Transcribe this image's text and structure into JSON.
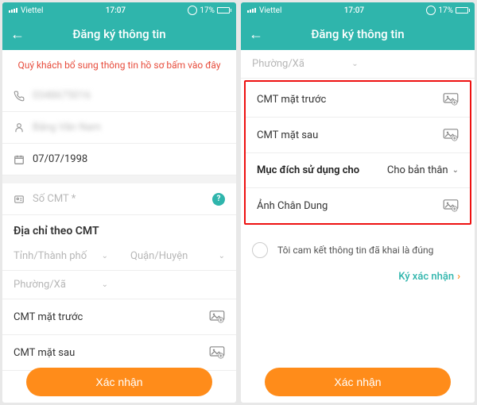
{
  "status": {
    "carrier": "Viettel",
    "time": "17:07",
    "battery_pct": "17%"
  },
  "nav": {
    "back_glyph": "←",
    "title": "Đăng ký thông tin"
  },
  "left": {
    "alert": "Quý khách bổ sung thông tin hồ sơ bấm vào đây",
    "phone_blur": "0348675016",
    "name_blur": "Bảng Văn Nam",
    "dob": "07/07/1998",
    "id_placeholder": "Số CMT *",
    "address_heading": "Địa chỉ theo CMT",
    "province": "Tỉnh/Thành phố",
    "district": "Quận/Huyện",
    "ward": "Phường/Xã",
    "id_front": "CMT mặt trước",
    "id_back": "CMT mặt sau"
  },
  "right": {
    "ward": "Phường/Xã",
    "id_front": "CMT mặt trước",
    "id_back": "CMT mặt sau",
    "purpose_label": "Mục đích sử dụng cho",
    "purpose_value": "Cho bản thân",
    "portrait": "Ảnh Chân Dung",
    "commit": "Tôi cam kết thông tin đã khai là đúng",
    "sign": "Ký xác nhận"
  },
  "cta": "Xác nhận"
}
